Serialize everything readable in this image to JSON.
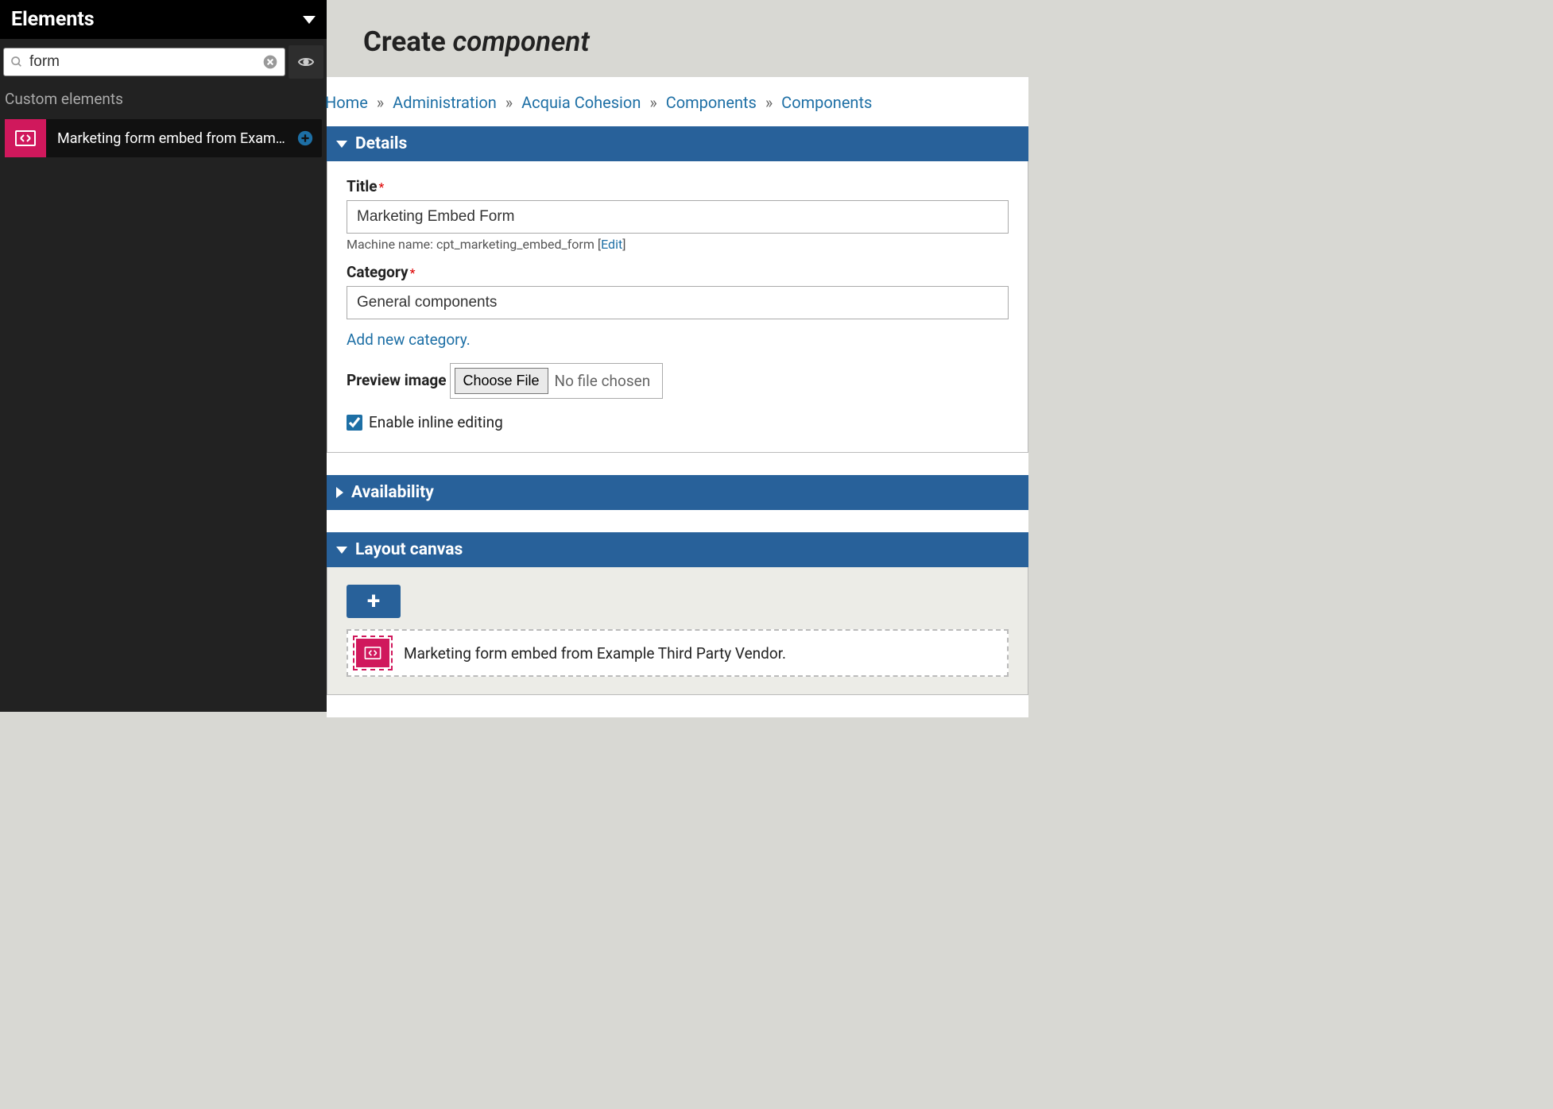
{
  "sidebar": {
    "title": "Elements",
    "search_value": "form",
    "group_label": "Custom elements",
    "item_label": "Marketing form embed from Exam…"
  },
  "page": {
    "title_prefix": "Create ",
    "title_em": "component"
  },
  "breadcrumb": {
    "items": [
      "Home",
      "Administration",
      "Acquia Cohesion",
      "Components",
      "Components"
    ],
    "sep": "»"
  },
  "panels": {
    "details": {
      "title": "Details"
    },
    "availability": {
      "title": "Availability"
    },
    "layout": {
      "title": "Layout canvas"
    }
  },
  "details": {
    "title_label": "Title",
    "title_value": "Marketing Embed Form",
    "machine_label": "Machine name: ",
    "machine_value": "cpt_marketing_embed_form",
    "machine_edit": "Edit",
    "category_label": "Category",
    "category_value": "General components",
    "add_category": "Add new category.",
    "preview_label": "Preview image",
    "choose_file": "Choose File",
    "no_file": "No file chosen",
    "inline_label": "Enable inline editing"
  },
  "canvas": {
    "item_label": "Marketing form embed from Example Third Party Vendor."
  },
  "colors": {
    "accent_blue": "#28619a",
    "accent_pink": "#d0185c",
    "link": "#1d6fa5"
  }
}
